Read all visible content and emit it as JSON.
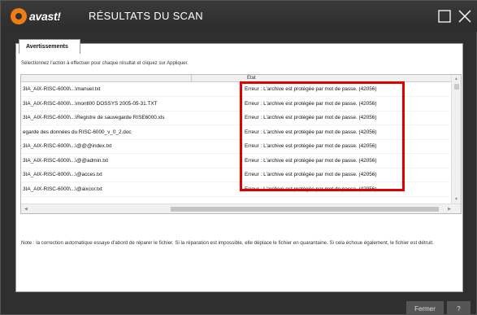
{
  "window": {
    "brand": "avast!",
    "title": "RÉSULTATS DU SCAN"
  },
  "tab_label": "Avertissements",
  "instructions": "Sélectionnez l'action à effectuer pour chaque résultat et cliquez sur Appliquer.",
  "table": {
    "status_header": "Etat",
    "rows": [
      {
        "file": "3IA_AIX-RISC-6000\\...\\manuel.txt",
        "status": "Erreur : L'archive est protégée par mot de passe. (42056)"
      },
      {
        "file": "3IA_AIX-RISC-6000\\...\\montl00 DOSSYS 2005-05-31.TXT",
        "status": "Erreur : L'archive est protégée par mot de passe. (42056)"
      },
      {
        "file": "3IA_AIX-RISC-6000\\...\\Registre de sauvegarde RISE6000.xls",
        "status": "Erreur : L'archive est protégée par mot de passe. (42056)"
      },
      {
        "file": "egarde des données du RISC-6000_v_0_2.doc",
        "status": "Erreur : L'archive est protégée par mot de passe. (42056)"
      },
      {
        "file": "3IA_AIX-RISC-6000\\...\\@@@index.txt",
        "status": "Erreur : L'archive est protégée par mot de passe. (42056)"
      },
      {
        "file": "3IA_AIX-RISC-6000\\...\\@@admin.txt",
        "status": "Erreur : L'archive est protégée par mot de passe. (42056)"
      },
      {
        "file": "3IA_AIX-RISC-6000\\...\\@acces.txt",
        "status": "Erreur : L'archive est protégée par mot de passe. (42056)"
      },
      {
        "file": "3IA_AIX-RISC-6000\\...\\@aixcor.txt",
        "status": "Erreur : L'archive est protégée par mot de passe. (42056)"
      }
    ]
  },
  "note": "Note : la correction automatique essaye d'abord de réparer le fichier. Si la réparation est impossible, elle déplace le fichier en quarantaine. Si cela échoue également, le fichier est détruit.",
  "buttons": {
    "close": "Fermer",
    "help": "?"
  },
  "colors": {
    "highlight": "#e00000",
    "brand_orange": "#f07d14",
    "window_bg": "#2f2f2f"
  },
  "icons": [
    "avast-logo-icon",
    "maximize-icon",
    "close-icon"
  ]
}
